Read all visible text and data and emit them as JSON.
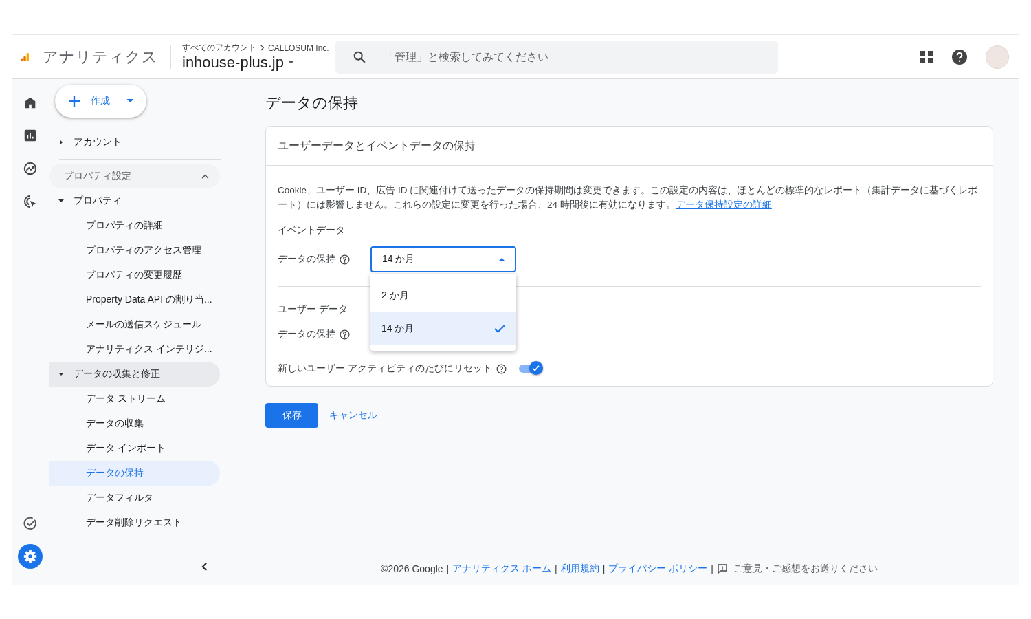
{
  "header": {
    "product": "アナリティクス",
    "breadcrumb": [
      "すべてのアカウント",
      "CALLOSUM Inc."
    ],
    "property": "inhouse-plus.jp",
    "search": {
      "placeholder": "「管理」と検索してみてください"
    }
  },
  "rail": {
    "top": [
      {
        "kind": "home",
        "selected": false
      },
      {
        "kind": "reports",
        "selected": false
      },
      {
        "kind": "explore",
        "selected": false
      },
      {
        "kind": "advertising",
        "selected": false
      }
    ],
    "bottom": [
      {
        "kind": "checklist",
        "selected": false
      },
      {
        "kind": "admin",
        "selected": true
      }
    ]
  },
  "nav": {
    "create_button": "作成",
    "account": {
      "label": "アカウント",
      "expanded": false
    },
    "section": {
      "label": "プロパティ設定",
      "expanded": true
    },
    "groups": [
      {
        "label": "プロパティ",
        "expanded": true,
        "highlighted": false,
        "children": [
          {
            "label": "プロパティの詳細",
            "selected": false
          },
          {
            "label": "プロパティのアクセス管理",
            "selected": false
          },
          {
            "label": "プロパティの変更履歴",
            "selected": false
          },
          {
            "label": "Property Data API の割り当...",
            "selected": false
          },
          {
            "label": "メールの送信スケジュール",
            "selected": false
          },
          {
            "label": "アナリティクス インテリジ...",
            "selected": false
          }
        ]
      },
      {
        "label": "データの収集と修正",
        "expanded": true,
        "highlighted": true,
        "children": [
          {
            "label": "データ ストリーム",
            "selected": false
          },
          {
            "label": "データの収集",
            "selected": false
          },
          {
            "label": "データ インポート",
            "selected": false
          },
          {
            "label": "データの保持",
            "selected": true
          },
          {
            "label": "データフィルタ",
            "selected": false
          },
          {
            "label": "データ削除リクエスト",
            "selected": false
          }
        ]
      }
    ]
  },
  "page": {
    "title": "データの保持",
    "card": {
      "title": "ユーザーデータとイベントデータの保持",
      "description": "Cookie、ユーザー ID、広告 ID に関連付けて送ったデータの保持期間は変更できます。この設定の内容は、ほとんどの標準的なレポート（集計データに基づくレポート）には影響しません。これらの設定に変更を行った場合、24 時間後に有効になります。",
      "link": "データ保持設定の詳細",
      "event_section": "イベントデータ",
      "event_label": "データの保持",
      "event_select": {
        "value": "14 か月",
        "expanded": true,
        "options": [
          {
            "label": "2 か月",
            "selected": false
          },
          {
            "label": "14 か月",
            "selected": true
          }
        ]
      },
      "user_section": "ユーザー データ",
      "user_label": "データの保持",
      "reset_label": "新しいユーザー アクティビティのたびにリセット",
      "reset_on": true
    },
    "save_button": "保存",
    "cancel_button": "キャンセル"
  },
  "footer": {
    "copyright": "©2026 Google",
    "separator": "|",
    "links": [
      "アナリティクス ホーム",
      "利用規約",
      "プライバシー ポリシー"
    ],
    "feedback": "ご意見・ご感想をお送りください"
  }
}
